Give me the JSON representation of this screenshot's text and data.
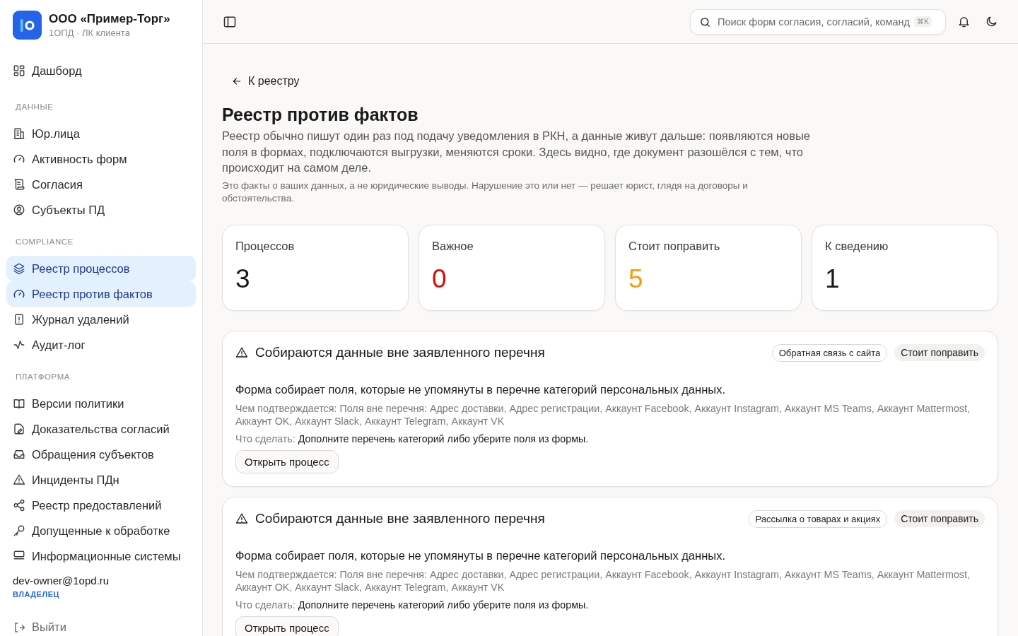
{
  "sidebar": {
    "org": {
      "name": "ООО «Пример-Торг»",
      "subtitle": "1ОПД · ЛК клиента"
    },
    "groups": [
      {
        "items": [
          {
            "label": "Дашборд",
            "selected": false
          }
        ]
      },
      {
        "heading": "ДАННЫЕ",
        "items": [
          {
            "label": "Юр.лица",
            "selected": false
          },
          {
            "label": "Активность форм",
            "selected": false
          },
          {
            "label": "Согласия",
            "selected": false
          },
          {
            "label": "Субъекты ПД",
            "selected": false
          }
        ]
      },
      {
        "heading": "COMPLIANCE",
        "items": [
          {
            "label": "Реестр процессов",
            "selected": true
          },
          {
            "label": "Реестр против фактов",
            "selected": true
          },
          {
            "label": "Журнал удалений",
            "selected": false
          },
          {
            "label": "Аудит-лог",
            "selected": false
          }
        ]
      },
      {
        "heading": "ПЛАТФОРМА",
        "items": [
          {
            "label": "Версии политики",
            "selected": false
          },
          {
            "label": "Доказательства согласий",
            "selected": false
          },
          {
            "label": "Обращения субъектов",
            "selected": false
          },
          {
            "label": "Инциденты ПДн",
            "selected": false
          },
          {
            "label": "Реестр предоставлений",
            "selected": false
          },
          {
            "label": "Допущенные к обработке",
            "selected": false
          },
          {
            "label": "Информационные системы",
            "selected": false
          }
        ]
      }
    ],
    "user": {
      "email": "dev-owner@1opd.ru",
      "role": "ВЛАДЕЛЕЦ"
    },
    "logout": "Выйти"
  },
  "header": {
    "search": {
      "placeholder": "Поиск форм согласия, согласий, команд",
      "shortcut": "⌘K"
    }
  },
  "page": {
    "back": "К реестру",
    "title": "Реестр против фактов",
    "intro": "Реестр обычно пишут один раз под подачу уведомления в РКН, а данные живут дальше: появляются новые поля в формах, подключаются выгрузки, меняются сроки. Здесь видно, где документ разошёлся с тем, что происходит на самом деле.",
    "note": "Это факты о ваших данных, а не юридические выводы. Нарушение это или нет — решает юрист, глядя на договоры и обстоятельства.",
    "stats": [
      {
        "label": "Процессов",
        "value": "3",
        "color": "#1a1a1a"
      },
      {
        "label": "Важное",
        "value": "0",
        "color": "#d40f0f"
      },
      {
        "label": "Стоит поправить",
        "value": "5",
        "color": "#f59e0b"
      },
      {
        "label": "К сведению",
        "value": "1",
        "color": "#1a1a1a"
      }
    ],
    "findings": [
      {
        "title": "Собираются данные вне заявленного перечня",
        "source": "Обратная связь с сайта",
        "severity": "Стоит поправить",
        "summary": "Форма собирает поля, которые не упомянуты в перечне категорий персональных данных.",
        "evidence_label": "Чем подтверждается:",
        "evidence": "Поля вне перечня: Адрес доставки, Адрес регистрации, Аккаунт Facebook, Аккаунт Instagram, Аккаунт MS Teams, Аккаунт Mattermost, Аккаунт OK, Аккаунт Slack, Аккаунт Telegram, Аккаунт VK",
        "action_label": "Что сделать:",
        "action": "Дополните перечень категорий либо уберите поля из формы.",
        "button": "Открыть процесс"
      },
      {
        "title": "Собираются данные вне заявленного перечня",
        "source": "Рассылка о товарах и акциях",
        "severity": "Стоит поправить",
        "summary": "Форма собирает поля, которые не упомянуты в перечне категорий персональных данных.",
        "evidence_label": "Чем подтверждается:",
        "evidence": "Поля вне перечня: Адрес доставки, Адрес регистрации, Аккаунт Facebook, Аккаунт Instagram, Аккаунт MS Teams, Аккаунт Mattermost, Аккаунт OK, Аккаунт Slack, Аккаунт Telegram, Аккаунт VK",
        "action_label": "Что сделать:",
        "action": "Дополните перечень категорий либо уберите поля из формы.",
        "button": "Открыть процесс"
      }
    ]
  }
}
